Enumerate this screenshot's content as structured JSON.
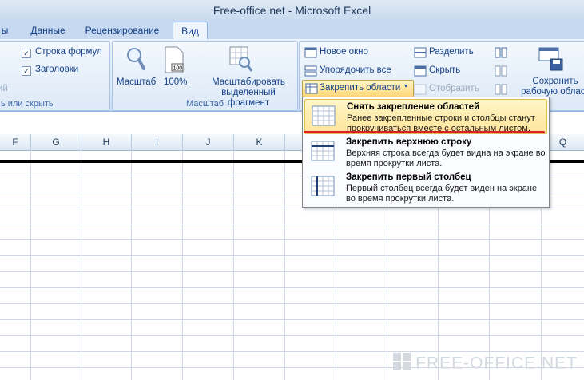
{
  "window": {
    "title": "Free-office.net - Microsoft Excel"
  },
  "tabs": [
    {
      "label": "ы"
    },
    {
      "label": "Данные"
    },
    {
      "label": "Рецензирование"
    },
    {
      "label": "Вид"
    }
  ],
  "ribbon": {
    "show_group": {
      "checkboxes": [
        {
          "label": "Строка формул",
          "checked": true
        },
        {
          "label": "Заголовки",
          "checked": true
        }
      ],
      "clipped_label": "ий",
      "group_label": "ь или скрыть"
    },
    "zoom_group": {
      "zoom_label": "Масштаб",
      "hundred_label": "100%",
      "zoom_selection_label": "Масштабировать выделенный фрагмент",
      "group_label": "Масштаб"
    },
    "window_group": {
      "new_window": "Новое окно",
      "arrange_all": "Упорядочить все",
      "freeze_panes": "Закрепить области",
      "split": "Разделить",
      "hide": "Скрыть",
      "unhide": "Отобразить",
      "save_workspace": "Сохранить рабочую област"
    }
  },
  "columns": [
    "F",
    "G",
    "H",
    "I",
    "J",
    "K",
    "Q"
  ],
  "freeze_menu": {
    "items": [
      {
        "title": "Снять закрепление областей",
        "desc": "Ранее закрепленные строки и столбцы станут прокручиваться вместе с остальным листом."
      },
      {
        "title": "Закрепить верхнюю строку",
        "desc": "Верхняя строка всегда будет видна на экране во время прокрутки листа."
      },
      {
        "title": "Закрепить первый столбец",
        "desc": "Первый столбец всегда будет виден на экране во время прокрутки листа."
      }
    ]
  },
  "watermark": "FREE-OFFICE.NET",
  "colors": {
    "accent_red": "#d9221f",
    "highlight": "#ffe49a",
    "ribbon": "#dbe8f7"
  }
}
